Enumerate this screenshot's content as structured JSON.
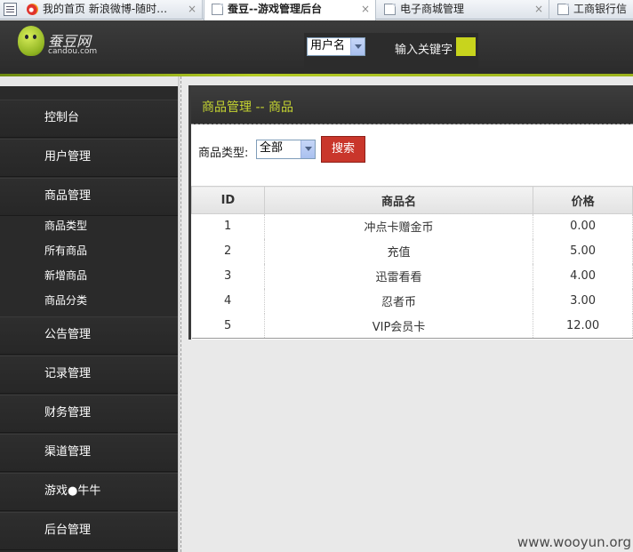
{
  "browser": {
    "tabs": [
      {
        "title": "我的首页 新浪微博-随时…",
        "close": "×"
      },
      {
        "title": "蚕豆--游戏管理后台",
        "close": "×"
      },
      {
        "title": "电子商城管理",
        "close": "×"
      },
      {
        "title": "工商银行信"
      }
    ]
  },
  "header": {
    "logo_cn": "蚕豆网",
    "logo_en": "candou.com",
    "search_field_select": "用户名",
    "keyword_label": "输入关键字"
  },
  "sidebar": {
    "items": [
      {
        "label": "控制台"
      },
      {
        "label": "用户管理"
      },
      {
        "label": "商品管理",
        "subitems": [
          "商品类型",
          "所有商品",
          "新增商品",
          "商品分类"
        ]
      },
      {
        "label": "公告管理"
      },
      {
        "label": "记录管理"
      },
      {
        "label": "财务管理"
      },
      {
        "label": "渠道管理"
      },
      {
        "label": "游戏●牛牛"
      },
      {
        "label": "后台管理"
      }
    ]
  },
  "main": {
    "title": "商品管理  -- 商品",
    "filter_label": "商品类型:",
    "filter_value": "全部",
    "search_button": "搜索",
    "table": {
      "headers": [
        "ID",
        "商品名",
        "价格"
      ],
      "rows": [
        [
          "1",
          "冲点卡赠金币",
          "0.00"
        ],
        [
          "2",
          "充值",
          "5.00"
        ],
        [
          "3",
          "迅雷看看",
          "4.00"
        ],
        [
          "4",
          "忍者币",
          "3.00"
        ],
        [
          "5",
          "VIP会员卡",
          "12.00"
        ]
      ]
    }
  },
  "watermark": "www.wooyun.org"
}
